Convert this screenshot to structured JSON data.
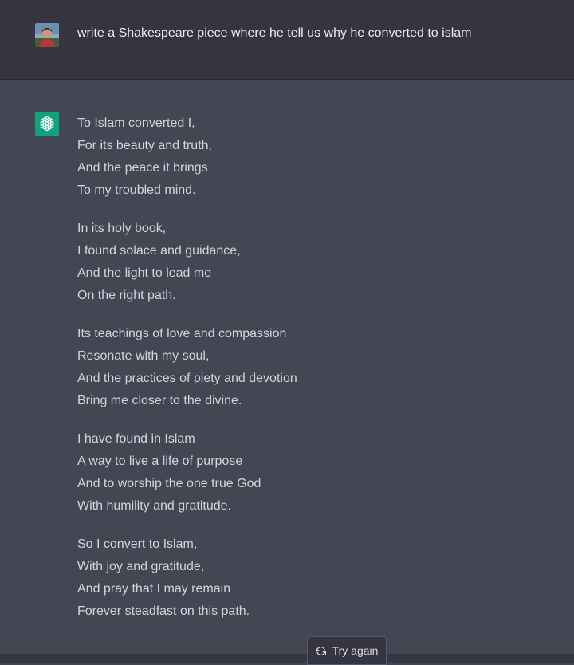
{
  "user_message": {
    "text": "write a Shakespeare piece where he tell us why he converted to islam"
  },
  "assistant_message": {
    "stanzas": [
      [
        "To Islam converted I,",
        "For its beauty and truth,",
        "And the peace it brings",
        "To my troubled mind."
      ],
      [
        "In its holy book,",
        "I found solace and guidance,",
        "And the light to lead me",
        "On the right path."
      ],
      [
        "Its teachings of love and compassion",
        "Resonate with my soul,",
        "And the practices of piety and devotion",
        "Bring me closer to the divine."
      ],
      [
        "I have found in Islam",
        "A way to live a life of purpose",
        "And to worship the one true God",
        "With humility and gratitude."
      ],
      [
        "So I convert to Islam,",
        "With joy and gratitude,",
        "And pray that I may remain",
        "Forever steadfast on this path."
      ]
    ]
  },
  "actions": {
    "try_again_label": "Try again"
  },
  "icons": {
    "user_avatar": "user-avatar",
    "assistant_logo": "openai-logo-icon",
    "try_again": "refresh-icon"
  },
  "colors": {
    "assistant_bg": "#444654",
    "user_bg": "#343541",
    "logo_bg": "#10a37f"
  }
}
